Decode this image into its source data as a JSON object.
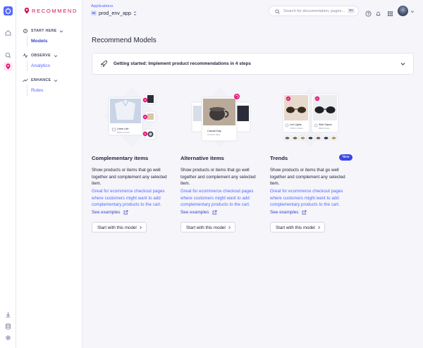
{
  "brand": {
    "name": "RECOMMEND",
    "color": "#d7105c"
  },
  "sidebar": {
    "sections": [
      {
        "label": "START HERE",
        "items": [
          {
            "label": "Models",
            "active": true
          }
        ]
      },
      {
        "label": "OBSERVE",
        "items": [
          {
            "label": "Analytics"
          }
        ]
      },
      {
        "label": "ENHANCE",
        "items": [
          {
            "label": "Rules"
          }
        ]
      }
    ]
  },
  "header": {
    "app_label": "Applications",
    "app_badge": "PE",
    "app_name": "prod_env_app",
    "search_placeholder": "Search for documentation, pages...",
    "search_shortcut": "⌘K"
  },
  "main": {
    "title": "Recommend Models",
    "getting_started": "Getting started: Implement product recommendations in 4 steps",
    "cards": [
      {
        "title": "Complementary items",
        "description": "Show products or items that go well together and complement any selected item.",
        "note": "Great for ecommerce checkout pages where customers might want to add complementary products to the cart.",
        "see_examples": "See examples",
        "button": "Start with this model",
        "image_labels": {
          "product": "Linen Life",
          "sub": "Button Finish"
        }
      },
      {
        "title": "Alternative items",
        "description": "Show products or items that go well together and complement any selected item.",
        "note": "Great for ecommerce checkout pages where customers might want to add complementary products to the cart.",
        "see_examples": "See examples",
        "button": "Start with this model",
        "image_labels": {
          "product": "Casual Day",
          "sub": "Ceramic Mug"
        }
      },
      {
        "title": "Trends",
        "badge": "New",
        "description": "Show products or items that go well together and complement any selected item.",
        "note": "Great for ecommerce checkout pages where customers might want to add complementary products to the cart.",
        "see_examples": "See examples",
        "button": "Start with this model",
        "image_labels": {
          "left": "Lee Lights",
          "left_sub": "Uniform Frame",
          "right": "Side Sapno",
          "right_sub": "Black Frame"
        }
      }
    ]
  },
  "colors": {
    "accent": "#5468ff",
    "pink": "#e5177a",
    "text": "#23263b",
    "bg": "#f5f5fa"
  },
  "icons": [
    "algolia-icon",
    "home-icon",
    "search-icon",
    "recommend-icon",
    "chevron-down-icon",
    "pulse-icon",
    "trend-icon",
    "question-icon",
    "bell-icon",
    "grid-icon",
    "rocket-icon",
    "external-link-icon",
    "chevron-right-icon",
    "download-icon",
    "database-icon",
    "gear-icon"
  ]
}
